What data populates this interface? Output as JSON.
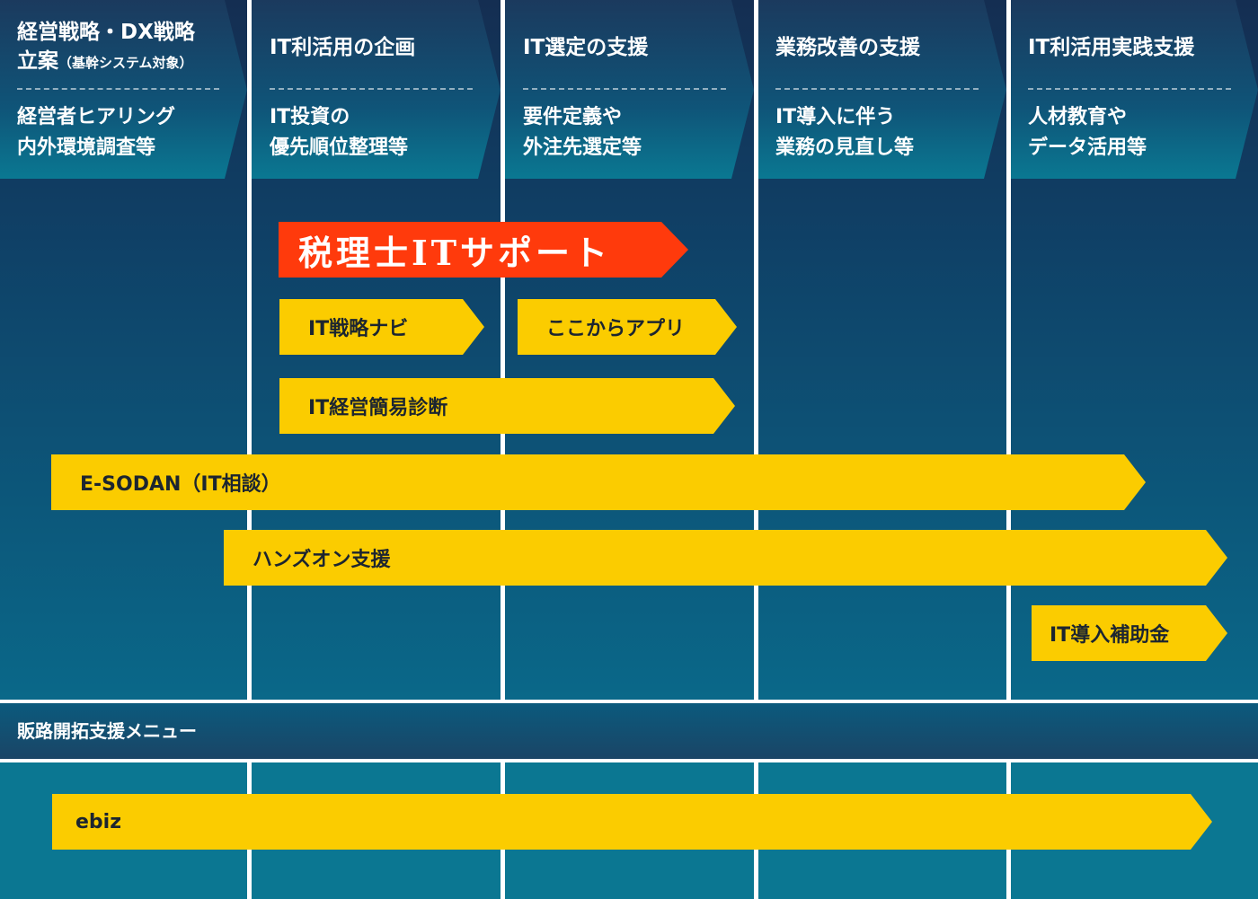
{
  "columns": [
    {
      "title_line1": "経営戦略・DX戦略",
      "title_line2_main": "立案",
      "title_line2_small": "（基幹システム対象）",
      "desc_line1": "経営者ヒアリング",
      "desc_line2": "内外環境調査等"
    },
    {
      "title": "IT利活用の企画",
      "desc_line1": "IT投資の",
      "desc_line2": "優先順位整理等"
    },
    {
      "title": "IT選定の支援",
      "desc_line1": "要件定義や",
      "desc_line2": "外注先選定等"
    },
    {
      "title": "業務改善の支援",
      "desc_line1": "IT導入に伴う",
      "desc_line2": "業務の見直し等"
    },
    {
      "title": "IT利活用実践支援",
      "desc_line1": "人材教育や",
      "desc_line2": "データ活用等"
    }
  ],
  "services": {
    "tax_support": "税理士ITサポート",
    "it_strategy_navi": "IT戦略ナビ",
    "kokokara_app": "ここからアプリ",
    "it_diagnosis": "IT経営簡易診断",
    "esodan": "E-SODAN（IT相談）",
    "hands_on": "ハンズオン支援",
    "it_subsidy": "IT導入補助金"
  },
  "sales_section": {
    "label": "販路開拓支援メニュー",
    "ebiz": "ebiz"
  },
  "colors": {
    "arrow_yellow": "#fbcc00",
    "tax_red": "#ff3a0c",
    "navy": "#142e52",
    "teal": "#0b7792"
  }
}
